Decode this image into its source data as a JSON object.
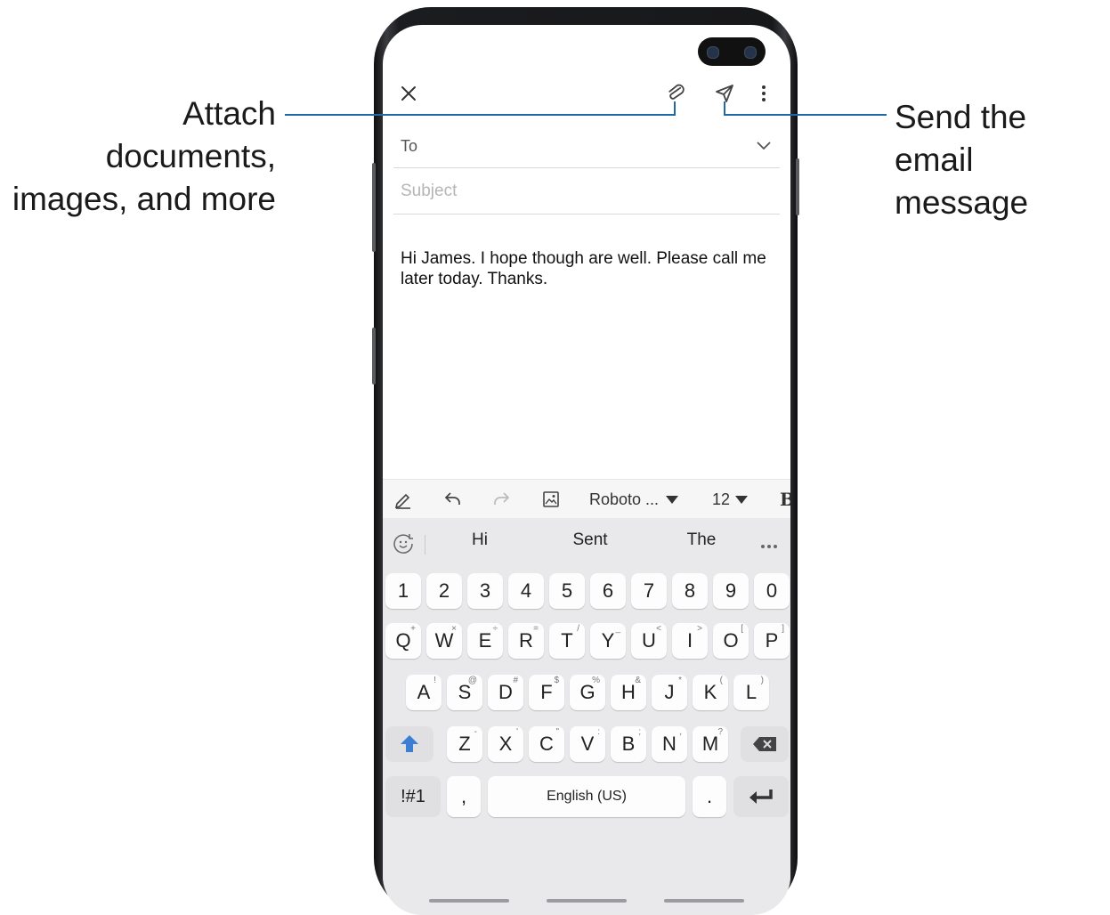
{
  "callouts": {
    "attach": [
      "Attach documents,",
      "images, and more"
    ],
    "send": [
      "Send the email",
      "message"
    ]
  },
  "compose": {
    "to_label": "To",
    "subject_placeholder": "Subject",
    "body": "Hi James.  I hope though are well. Please call me later today. Thanks."
  },
  "toolbar": {
    "font": "Roboto ...",
    "size": "12",
    "bold": "B"
  },
  "keyboard": {
    "suggestions": [
      "Hi",
      "Sent",
      "The"
    ],
    "number_row": [
      "1",
      "2",
      "3",
      "4",
      "5",
      "6",
      "7",
      "8",
      "9",
      "0"
    ],
    "row1": [
      {
        "k": "Q",
        "s": "+"
      },
      {
        "k": "W",
        "s": "×"
      },
      {
        "k": "E",
        "s": "÷"
      },
      {
        "k": "R",
        "s": "="
      },
      {
        "k": "T",
        "s": "/"
      },
      {
        "k": "Y",
        "s": "_"
      },
      {
        "k": "U",
        "s": "<"
      },
      {
        "k": "I",
        "s": ">"
      },
      {
        "k": "O",
        "s": "["
      },
      {
        "k": "P",
        "s": "]"
      }
    ],
    "row2": [
      {
        "k": "A",
        "s": "!"
      },
      {
        "k": "S",
        "s": "@"
      },
      {
        "k": "D",
        "s": "#"
      },
      {
        "k": "F",
        "s": "$"
      },
      {
        "k": "G",
        "s": "%"
      },
      {
        "k": "H",
        "s": "&"
      },
      {
        "k": "J",
        "s": "*"
      },
      {
        "k": "K",
        "s": "("
      },
      {
        "k": "L",
        "s": ")"
      }
    ],
    "row3": [
      {
        "k": "Z",
        "s": "-"
      },
      {
        "k": "X",
        "s": "'"
      },
      {
        "k": "C",
        "s": "\""
      },
      {
        "k": "V",
        "s": ":"
      },
      {
        "k": "B",
        "s": ";"
      },
      {
        "k": "N",
        "s": ","
      },
      {
        "k": "M",
        "s": "?"
      }
    ],
    "symbols_label": "!#1",
    "comma": ",",
    "space_label": "English (US)",
    "period": "."
  },
  "colors": {
    "callout_line": "#1f6aa5",
    "shift_arrow": "#3b7fd4"
  }
}
